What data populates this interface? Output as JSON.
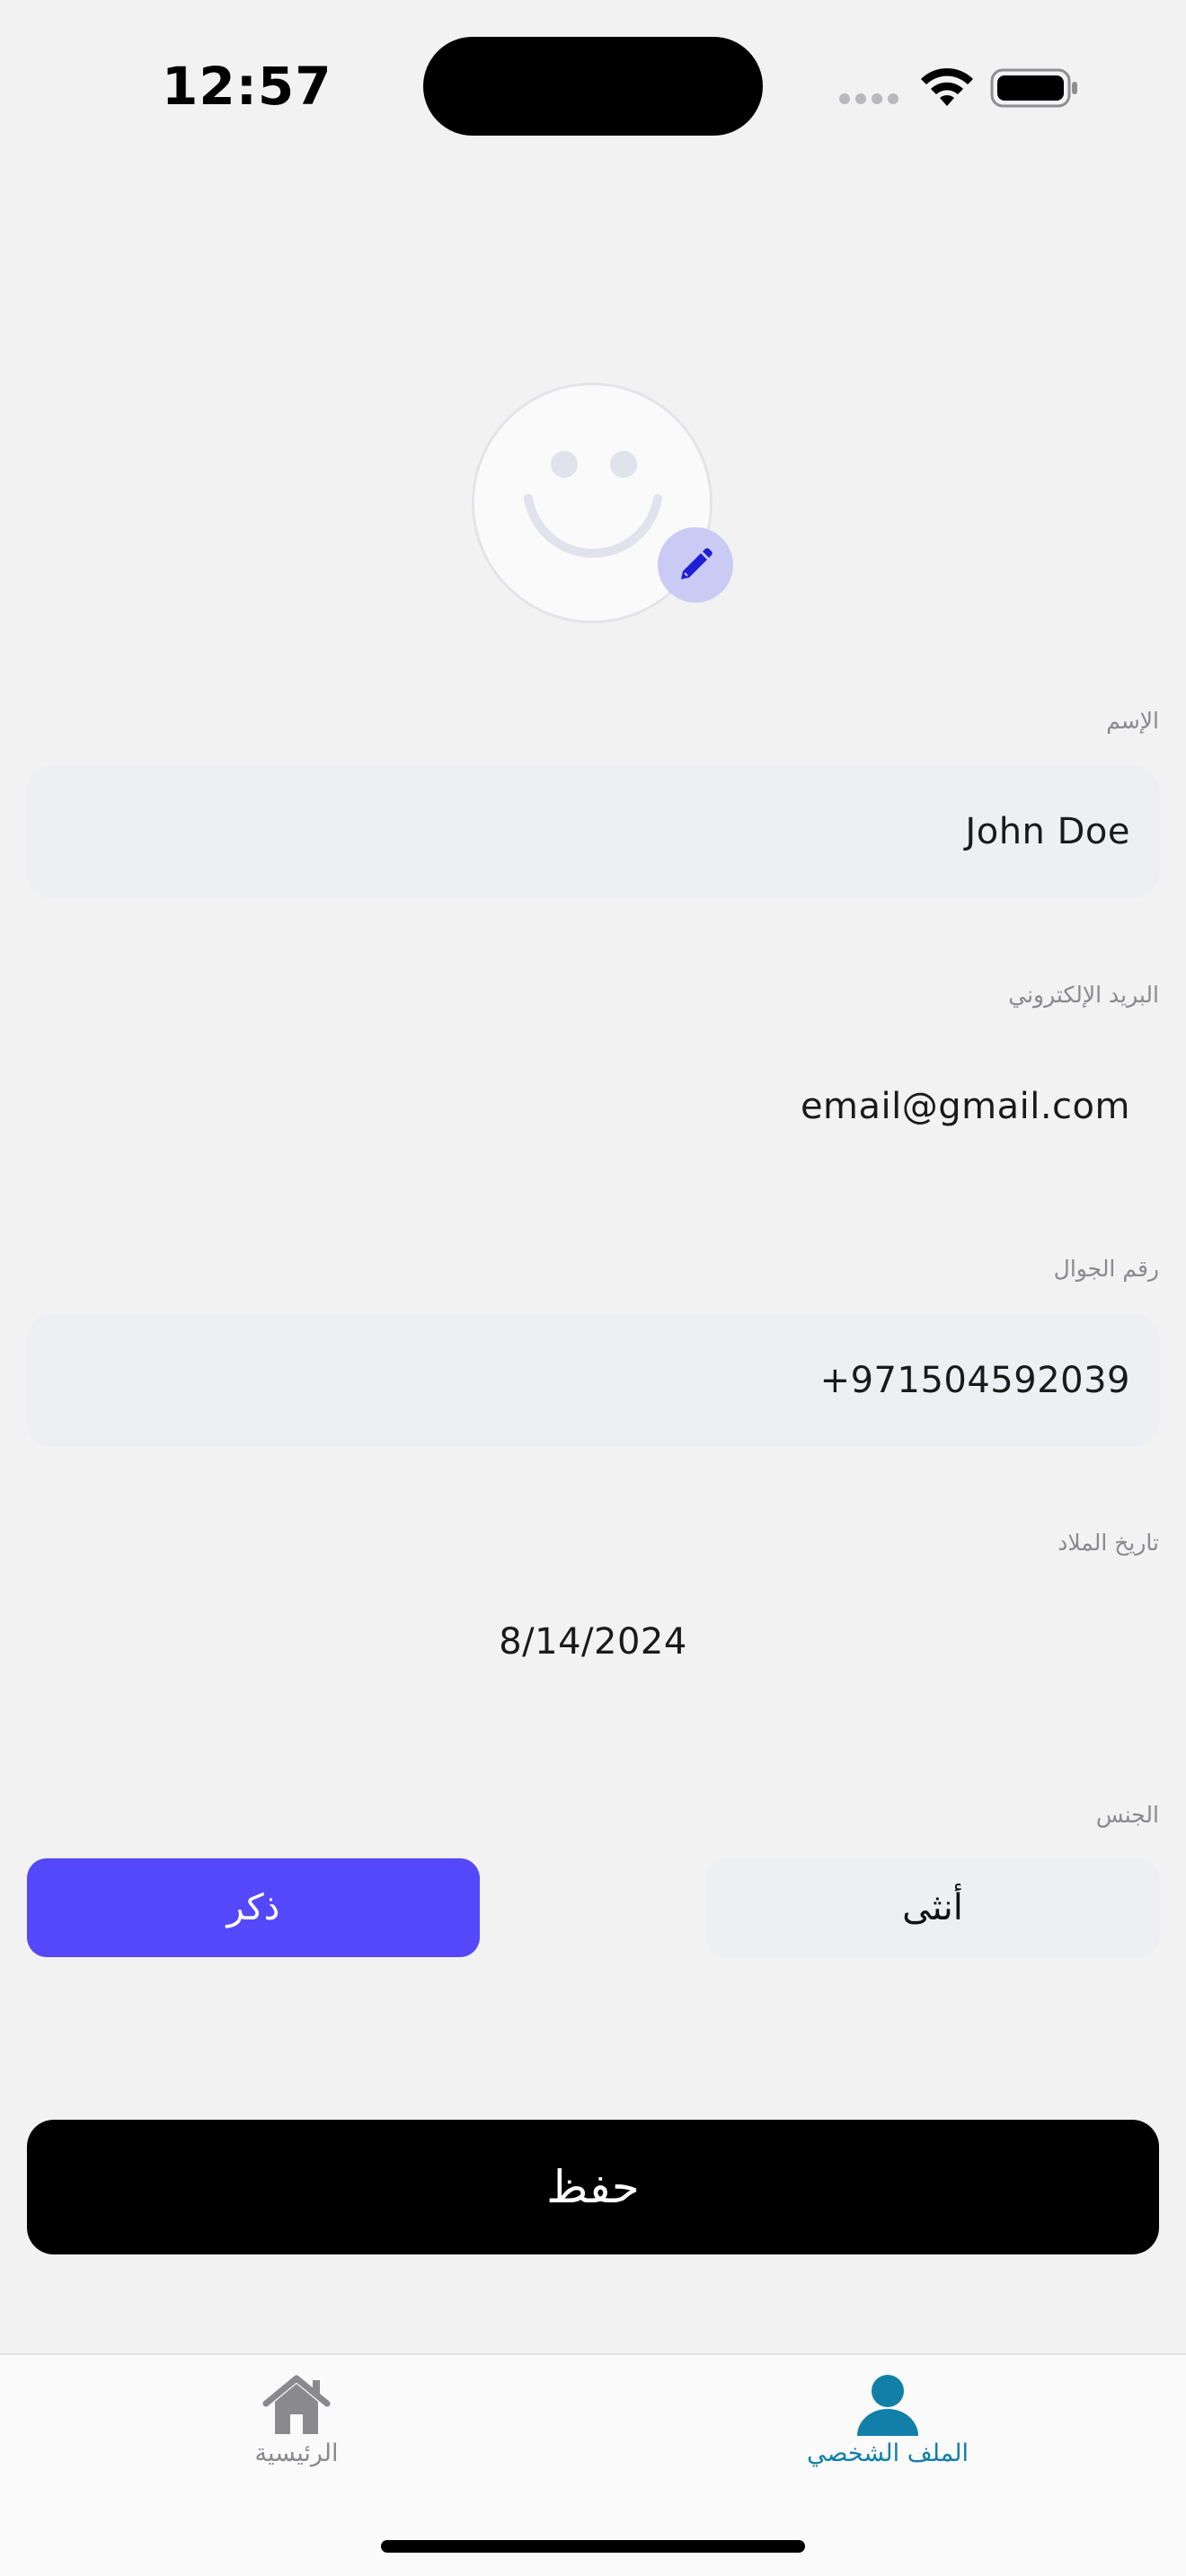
{
  "status_bar": {
    "time": "12:57",
    "icons": [
      "cellular-signal-icon",
      "wifi-icon",
      "battery-icon"
    ]
  },
  "avatar": {
    "icon": "smiley-face-icon",
    "edit_icon": "pencil-icon",
    "accent_color": "#c9cbf5"
  },
  "form": {
    "name": {
      "label": "الإسم",
      "value": "John Doe"
    },
    "email": {
      "label": "البريد الإلكتروني",
      "value": "email@gmail.com"
    },
    "phone": {
      "label": "رقم الجوال",
      "value": "+971504592039"
    },
    "birthdate": {
      "label": "تاريخ الملاد",
      "value": "8/14/2024"
    },
    "gender": {
      "label": "الجنس",
      "options": [
        {
          "label": "ذكر",
          "selected": true
        },
        {
          "label": "أنثى",
          "selected": false
        }
      ],
      "selected_color": "#5548fb"
    }
  },
  "save_label": "حفظ",
  "tab_bar": {
    "items": [
      {
        "label": "الرئيسية",
        "icon": "home-icon",
        "active": false
      },
      {
        "label": "الملف الشخصي",
        "icon": "person-icon",
        "active": true
      }
    ],
    "active_color": "#127fa8",
    "inactive_color": "#8a8a8e"
  }
}
